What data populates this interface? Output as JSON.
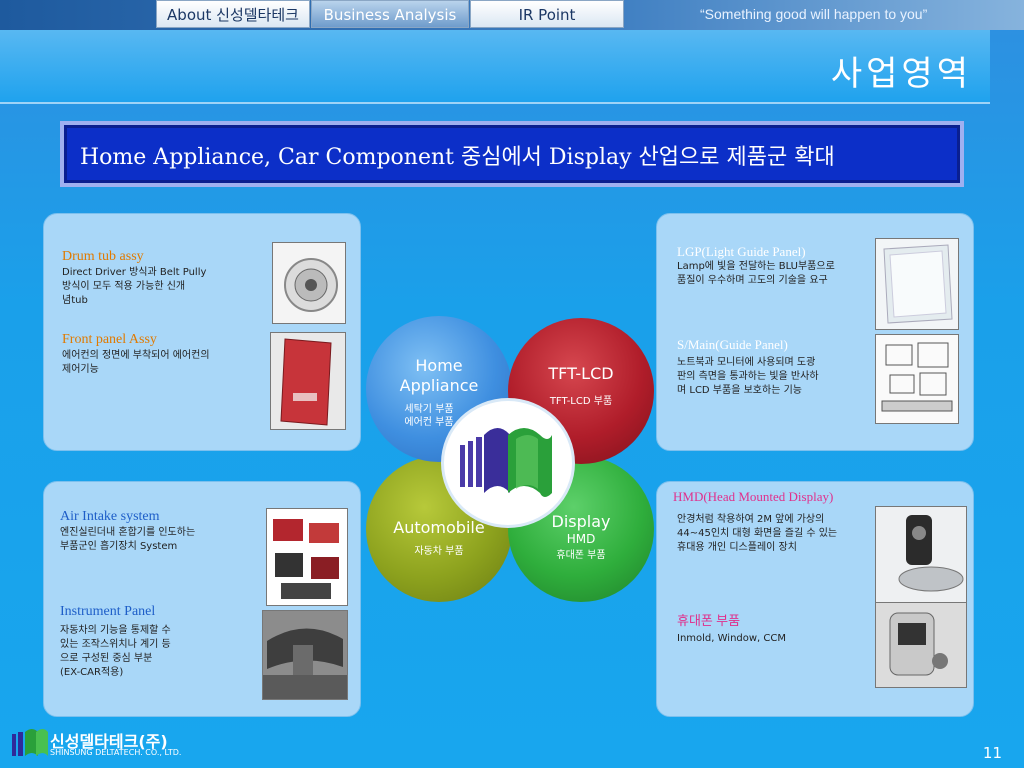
{
  "nav": {
    "tabs": [
      {
        "label": "About 신성델타테크"
      },
      {
        "label": "Business Analysis"
      },
      {
        "label": "IR Point"
      }
    ],
    "slogan": "“Something good will happen to you”"
  },
  "page_title": "사업영역",
  "banner": "Home Appliance, Car Component 중심에서 Display 산업으로 제품군 확대",
  "panels": {
    "home": {
      "item1": {
        "title": "Drum tub assy",
        "desc": [
          "Direct Driver 방식과 Belt Pully",
          "방식이 모두 적용 가능한 신개",
          "념tub"
        ]
      },
      "item2": {
        "title": "Front panel Assy",
        "desc": [
          "에어컨의 정면에 부착되어 에어컨의",
          "제어기능"
        ]
      }
    },
    "tft": {
      "item1": {
        "title": "LGP(Light Guide Panel)",
        "desc": [
          "Lamp에 빛을 전달하는 BLU부품으로",
          "품질이 우수하며 고도의 기술을 요구"
        ]
      },
      "item2": {
        "title": "S/Main(Guide Panel)",
        "desc": [
          "노트북과 모니터에 사용되며 도광",
          "판의 측면을 통과하는 빛을 반사하",
          "며 LCD 부품을 보호하는 기능"
        ]
      }
    },
    "auto": {
      "item1": {
        "title": "Air Intake system",
        "desc": [
          "엔진실린더내 혼합기를 인도하는",
          "부품군인 흡기장치 System"
        ]
      },
      "item2": {
        "title": "Instrument Panel",
        "desc": [
          "자동차의 기능을 통제할 수",
          "있는 조작스위치나 계기 등",
          "으로 구성된 중심 부분",
          "(EX-CAR적용)"
        ]
      }
    },
    "display": {
      "item1": {
        "title": "HMD(Head Mounted Display)",
        "desc": [
          "안경처럼 착용하여 2M 앞에 가상의",
          "44~45인치 대형 화면을 즐길 수 있는",
          "휴대용 개인 디스플레이 장치"
        ]
      },
      "item2": {
        "title": "휴대폰 부품",
        "desc": [
          "Inmold, Window, CCM"
        ]
      }
    }
  },
  "circles": {
    "home": {
      "title1": "Home",
      "title2": "Appliance",
      "sub1": "세탁기 부품",
      "sub2": "에어컨 부품",
      "color": "#3f8fe0"
    },
    "tft": {
      "title": "TFT-LCD",
      "sub": "TFT-LCD 부품",
      "color": "#b01d2a"
    },
    "auto": {
      "title": "Automobile",
      "sub": "자동차 부품",
      "color": "#8da21e"
    },
    "display": {
      "title": "Display",
      "title2": "HMD",
      "sub": "휴대폰 부품",
      "color": "#2fae3c"
    }
  },
  "colors": {
    "orange_title": "#e07a00",
    "blue_title": "#1e5ec8",
    "magenta_title": "#e0308c",
    "white_title": "#ffffff"
  },
  "logo": {
    "name": "신성델타테크(주)",
    "sub": "SHINSUNG DELTATECH. CO., LTD."
  },
  "page_number": "11"
}
